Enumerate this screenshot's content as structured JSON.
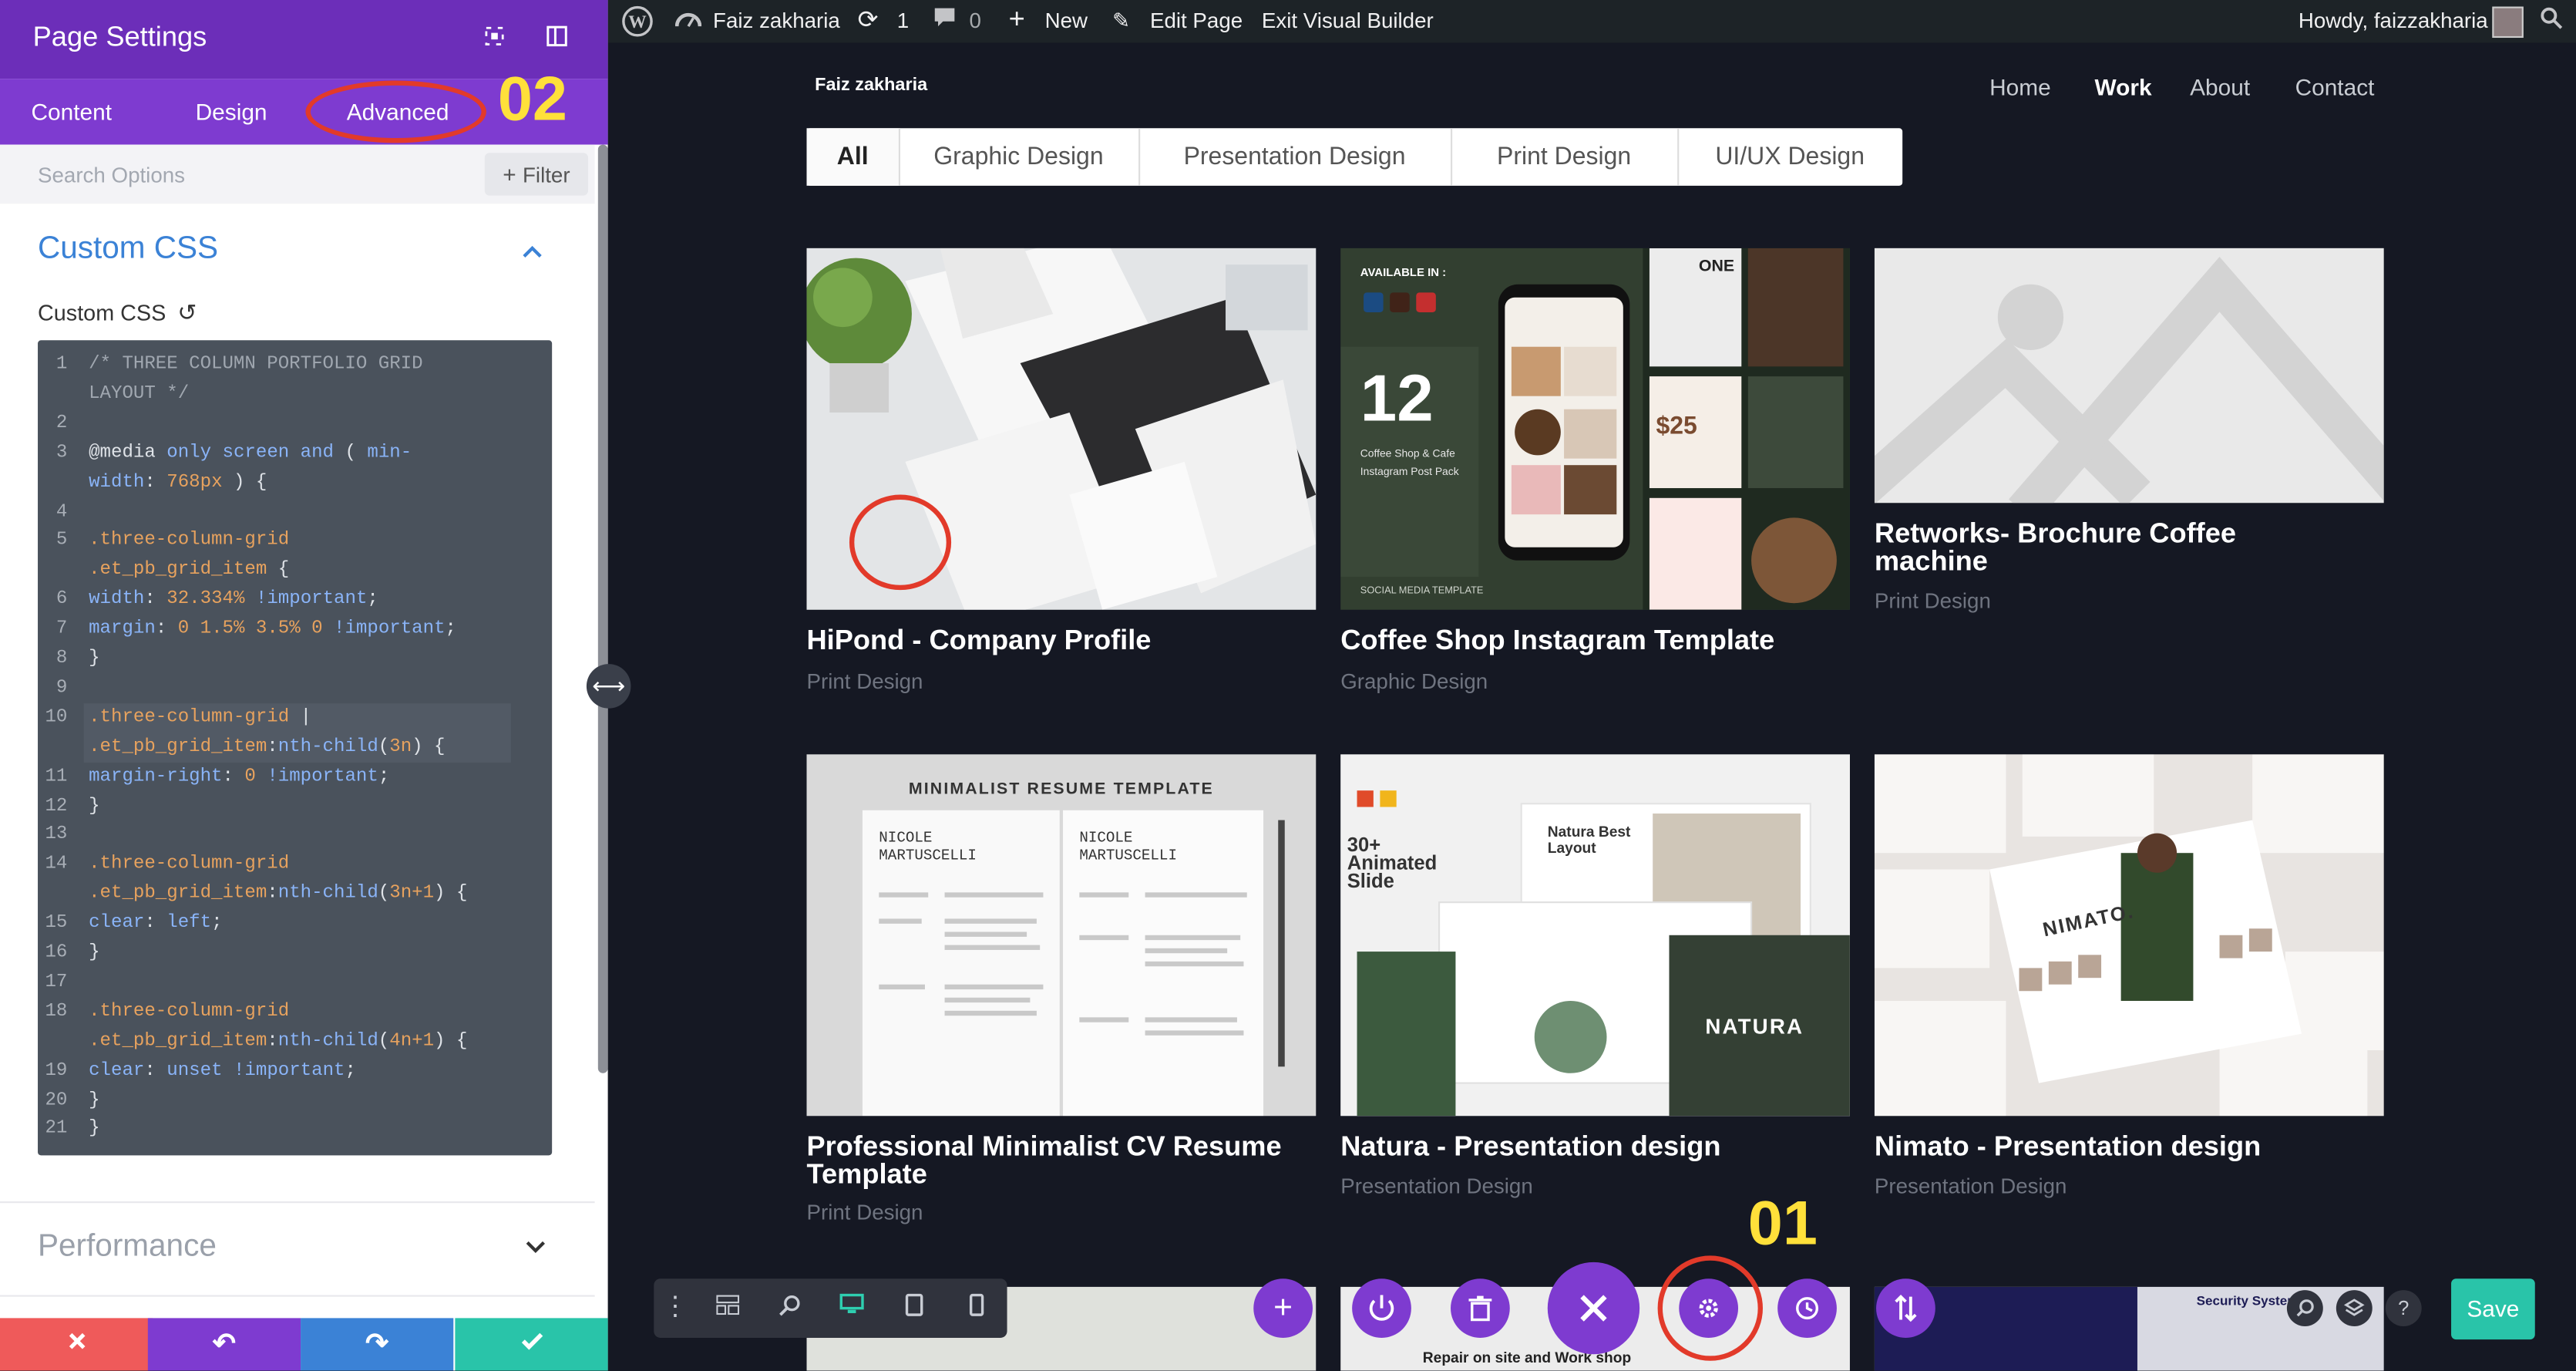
{
  "panel": {
    "title": "Page Settings",
    "tabs": [
      "Content",
      "Design",
      "Advanced"
    ],
    "step_label": "02",
    "search_placeholder": "Search Options",
    "filter_label": "Filter",
    "section_title": "Custom CSS",
    "field_label": "Custom CSS",
    "performance_title": "Performance",
    "accent_color": "#6c2eb9",
    "code_lines": [
      {
        "n": "1",
        "parts": [
          {
            "t": "/* THREE COLUMN PORTFOLIO GRID",
            "c": "cm"
          }
        ]
      },
      {
        "n": "",
        "parts": [
          {
            "t": "LAYOUT */",
            "c": "cm"
          }
        ]
      },
      {
        "n": "2",
        "parts": []
      },
      {
        "n": "3",
        "parts": [
          {
            "t": "@media ",
            "c": ""
          },
          {
            "t": "only screen and",
            "c": "kw"
          },
          {
            "t": " ( ",
            "c": ""
          },
          {
            "t": "min-",
            "c": "kw"
          }
        ]
      },
      {
        "n": "",
        "parts": [
          {
            "t": "width",
            "c": "kw"
          },
          {
            "t": ": ",
            "c": ""
          },
          {
            "t": "768px",
            "c": "num"
          },
          {
            "t": " ) {",
            "c": ""
          }
        ]
      },
      {
        "n": "4",
        "parts": []
      },
      {
        "n": "5",
        "parts": [
          {
            "t": ".three-column-grid",
            "c": "sel"
          }
        ]
      },
      {
        "n": "",
        "parts": [
          {
            "t": ".et_pb_grid_item",
            "c": "sel"
          },
          {
            "t": " {",
            "c": ""
          }
        ]
      },
      {
        "n": "6",
        "parts": [
          {
            "t": "width",
            "c": "kw"
          },
          {
            "t": ": ",
            "c": ""
          },
          {
            "t": "32.334%",
            "c": "num"
          },
          {
            "t": " !important",
            "c": "imp"
          },
          {
            "t": ";",
            "c": ""
          }
        ]
      },
      {
        "n": "7",
        "parts": [
          {
            "t": "margin",
            "c": "kw"
          },
          {
            "t": ": ",
            "c": ""
          },
          {
            "t": "0 1.5% 3.5% 0",
            "c": "num"
          },
          {
            "t": " !important",
            "c": "imp"
          },
          {
            "t": ";",
            "c": ""
          }
        ]
      },
      {
        "n": "8",
        "parts": [
          {
            "t": "}",
            "c": ""
          }
        ]
      },
      {
        "n": "9",
        "parts": []
      },
      {
        "n": "10",
        "parts": [
          {
            "t": ".three-column-grid",
            "c": "sel"
          },
          {
            "t": " |",
            "c": ""
          }
        ]
      },
      {
        "n": "",
        "parts": [
          {
            "t": ".et_pb_grid_item",
            "c": "sel"
          },
          {
            "t": ":",
            "c": ""
          },
          {
            "t": "nth-child",
            "c": "kw"
          },
          {
            "t": "(",
            "c": ""
          },
          {
            "t": "3n",
            "c": "num"
          },
          {
            "t": ") {",
            "c": ""
          }
        ]
      },
      {
        "n": "11",
        "parts": [
          {
            "t": "margin-right",
            "c": "kw"
          },
          {
            "t": ": ",
            "c": ""
          },
          {
            "t": "0",
            "c": "num"
          },
          {
            "t": " !important",
            "c": "imp"
          },
          {
            "t": ";",
            "c": ""
          }
        ]
      },
      {
        "n": "12",
        "parts": [
          {
            "t": "}",
            "c": ""
          }
        ]
      },
      {
        "n": "13",
        "parts": []
      },
      {
        "n": "14",
        "parts": [
          {
            "t": ".three-column-grid",
            "c": "sel"
          }
        ]
      },
      {
        "n": "",
        "parts": [
          {
            "t": ".et_pb_grid_item",
            "c": "sel"
          },
          {
            "t": ":",
            "c": ""
          },
          {
            "t": "nth-child",
            "c": "kw"
          },
          {
            "t": "(",
            "c": ""
          },
          {
            "t": "3n+1",
            "c": "num"
          },
          {
            "t": ") {",
            "c": ""
          }
        ]
      },
      {
        "n": "15",
        "parts": [
          {
            "t": "clear",
            "c": "kw"
          },
          {
            "t": ": ",
            "c": ""
          },
          {
            "t": "left",
            "c": "kw"
          },
          {
            "t": ";",
            "c": ""
          }
        ]
      },
      {
        "n": "16",
        "parts": [
          {
            "t": "}",
            "c": ""
          }
        ]
      },
      {
        "n": "17",
        "parts": []
      },
      {
        "n": "18",
        "parts": [
          {
            "t": ".three-column-grid",
            "c": "sel"
          }
        ]
      },
      {
        "n": "",
        "parts": [
          {
            "t": ".et_pb_grid_item",
            "c": "sel"
          },
          {
            "t": ":",
            "c": ""
          },
          {
            "t": "nth-child",
            "c": "kw"
          },
          {
            "t": "(",
            "c": ""
          },
          {
            "t": "4n+1",
            "c": "num"
          },
          {
            "t": ") {",
            "c": ""
          }
        ]
      },
      {
        "n": "19",
        "parts": [
          {
            "t": "clear",
            "c": "kw"
          },
          {
            "t": ": ",
            "c": ""
          },
          {
            "t": "unset",
            "c": "kw"
          },
          {
            "t": " !important",
            "c": "imp"
          },
          {
            "t": ";",
            "c": ""
          }
        ]
      },
      {
        "n": "20",
        "parts": [
          {
            "t": "}",
            "c": ""
          }
        ]
      },
      {
        "n": "21",
        "parts": [
          {
            "t": "}",
            "c": ""
          }
        ]
      }
    ]
  },
  "adminbar": {
    "site_name": "Faiz zakharia",
    "updates_count": "1",
    "comments_count": "0",
    "new_label": "New",
    "edit_label": "Edit Page",
    "exit_label": "Exit Visual Builder",
    "howdy": "Howdy, faizzakharia"
  },
  "site": {
    "logo_text": "Faiz zakharia",
    "nav": [
      "Home",
      "Work",
      "About",
      "Contact"
    ],
    "active_nav": "Work",
    "filters": [
      "All",
      "Graphic Design",
      "Presentation Design",
      "Print Design",
      "UI/UX Design"
    ],
    "active_filter": "All",
    "projects": [
      {
        "title": "HiPond - Company Profile",
        "category": "Print Design"
      },
      {
        "title": "Coffee Shop Instagram Template",
        "category": "Graphic Design"
      },
      {
        "title": "Retworks- Brochure Coffee machine",
        "category": "Print Design"
      },
      {
        "title": "Professional Minimalist CV Resume Template",
        "category": "Print Design"
      },
      {
        "title": "Natura - Presentation design",
        "category": "Presentation Design"
      },
      {
        "title": "Nimato - Presentation design",
        "category": "Presentation Design"
      }
    ],
    "thumb_text": {
      "coffee_available": "AVAILABLE IN :",
      "coffee_number": "12",
      "coffee_sub": "Coffee Shop & Cafe Instagram Post Pack",
      "coffee_footer": "SOCIAL MEDIA TEMPLATE",
      "coffee_price": "$25",
      "coffee_one": "ONE",
      "resume_header": "MINIMALIST RESUME TEMPLATE",
      "resume_name": "NICOLE MARTUSCELLI",
      "natura_badge": "30+ Animated Slide",
      "natura_layout": "Natura Best Layout",
      "natura_word": "NATURA",
      "nimato_word": "NIMATO.",
      "bottom_repair": "Repair on site and Work shop",
      "bottom_security": "Security System"
    }
  },
  "builder": {
    "step_label": "01",
    "save_label": "Save",
    "help_label": "?"
  }
}
